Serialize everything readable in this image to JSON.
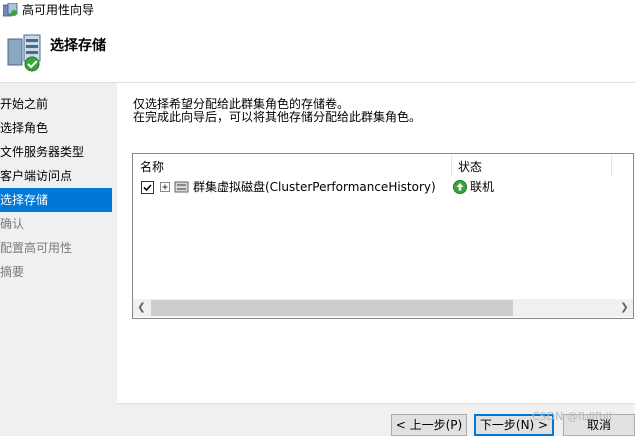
{
  "window": {
    "title": "高可用性向导"
  },
  "header": {
    "title": "选择存储"
  },
  "steps": [
    {
      "label": "开始之前",
      "state": "done"
    },
    {
      "label": "选择角色",
      "state": "done"
    },
    {
      "label": "文件服务器类型",
      "state": "done"
    },
    {
      "label": "客户端访问点",
      "state": "done"
    },
    {
      "label": "选择存储",
      "state": "active"
    },
    {
      "label": "确认",
      "state": "pending"
    },
    {
      "label": "配置高可用性",
      "state": "pending"
    },
    {
      "label": "摘要",
      "state": "pending"
    }
  ],
  "description": {
    "line1": "仅选择希望分配给此群集角色的存储卷。",
    "line2": "在完成此向导后，可以将其他存储分配给此群集角色。"
  },
  "table": {
    "columns": [
      "名称",
      "状态"
    ],
    "rows": [
      {
        "checked": true,
        "name": "群集虚拟磁盘(ClusterPerformanceHistory)",
        "status": "联机"
      }
    ]
  },
  "buttons": {
    "back": "< 上一步(P)",
    "next": "下一步(N) >",
    "cancel": "取消"
  },
  "watermark": "CSDN @fbllfbll",
  "colors": {
    "selection": "#0078d7",
    "status_ok": "#3aa53a"
  }
}
